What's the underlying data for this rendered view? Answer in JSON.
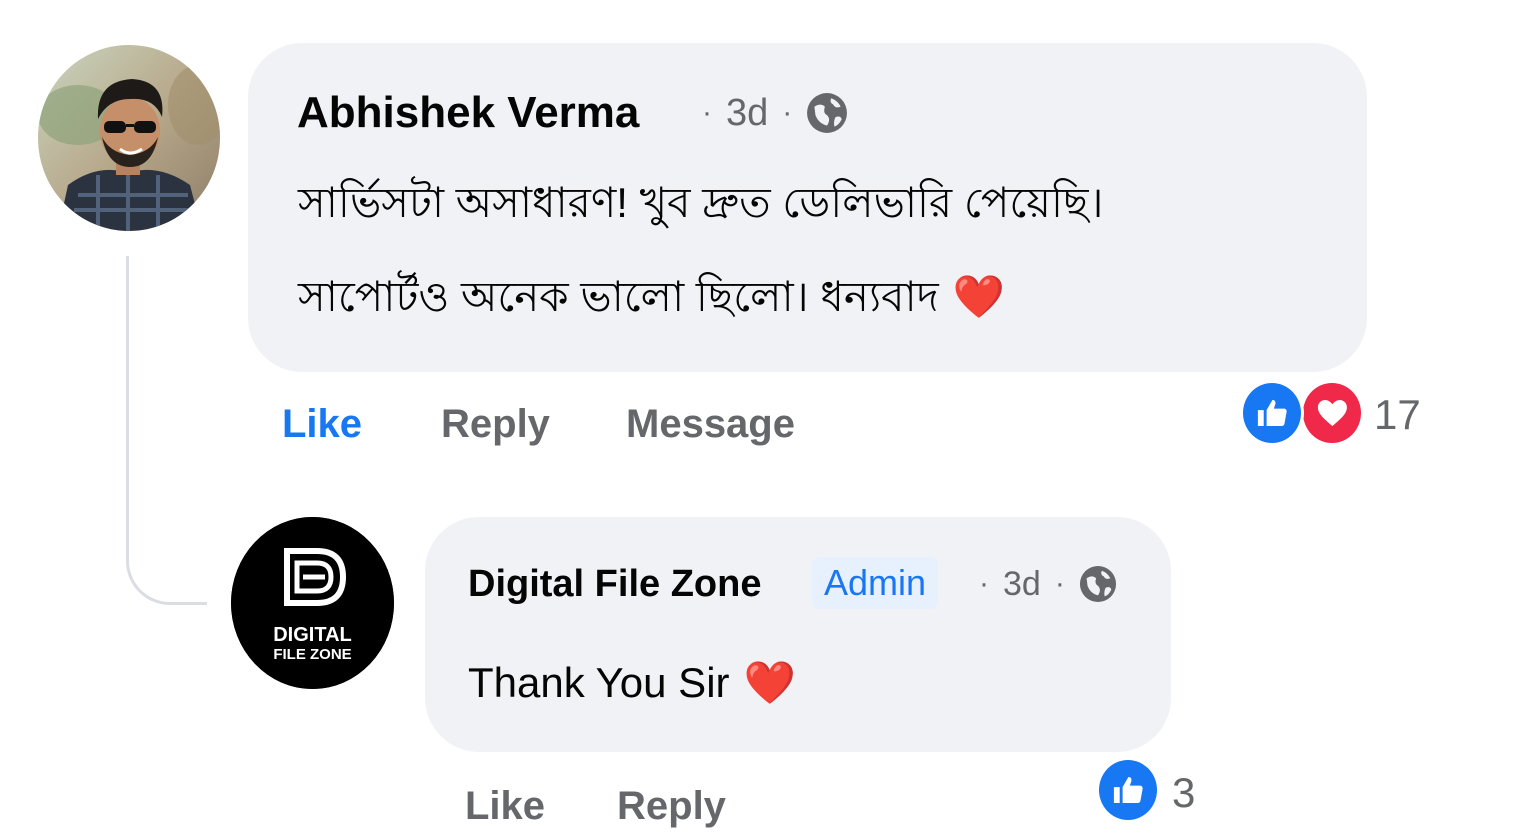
{
  "comment": {
    "author": "Abhishek Verma",
    "time": "3d",
    "separator": "·",
    "privacy_icon": "globe-icon",
    "lines": [
      "সার্ভিসটা অসাধারণ! খুব দ্রুত ডেলিভারি পেয়েছি।",
      "সাপোর্টও অনেক ভালো ছিলো। ধন্যবাদ"
    ],
    "emoji": "❤️",
    "actions": {
      "like": "Like",
      "reply": "Reply",
      "message": "Message"
    },
    "like_active": true,
    "reactions": [
      "like-icon",
      "love-icon"
    ],
    "reaction_count": "17"
  },
  "reply": {
    "author": "Digital File Zone",
    "badge": "Admin",
    "time": "3d",
    "separator": "·",
    "privacy_icon": "globe-icon",
    "text": "Thank You Sir",
    "emoji": "❤️",
    "actions": {
      "like": "Like",
      "reply": "Reply"
    },
    "reactions": [
      "like-icon"
    ],
    "reaction_count": "3",
    "logo": {
      "line1": "DIGITAL",
      "line2": "FILE ZONE"
    }
  },
  "colors": {
    "accent": "#1877f2",
    "love": "#f0284a",
    "bubble": "#f0f2f5",
    "muted": "#65676b",
    "text": "#050505"
  }
}
